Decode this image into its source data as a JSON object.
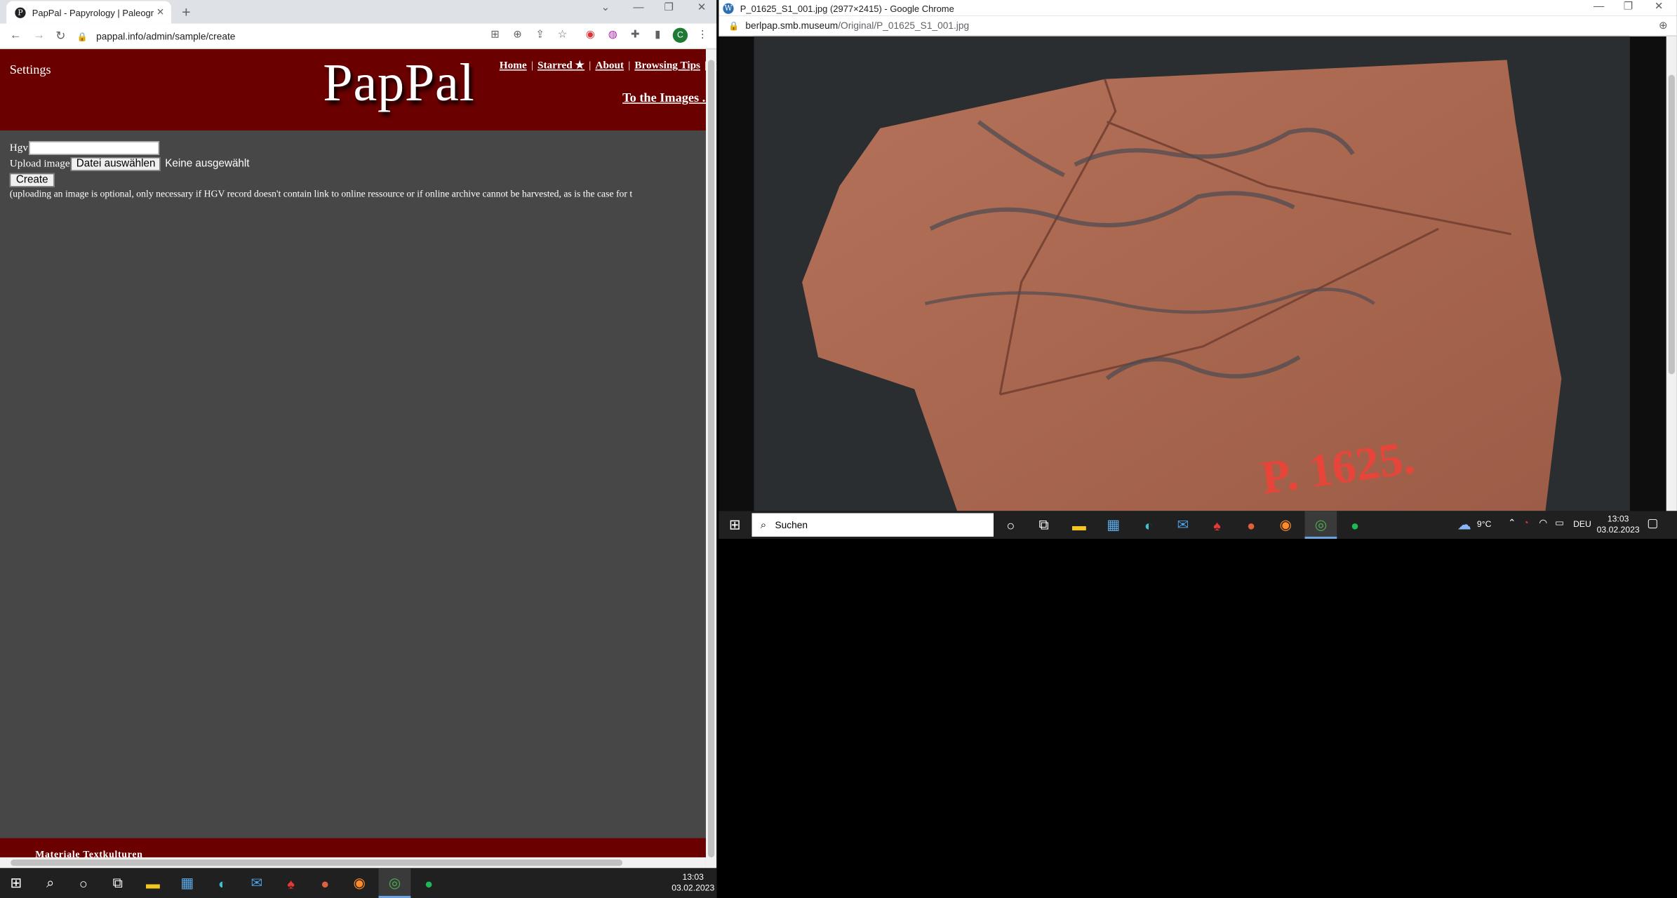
{
  "left_window": {
    "tab_title": "PapPal - Papyrology | Paleograph",
    "tab_close": "✕",
    "new_tab": "+",
    "url": "pappal.info/admin/sample/create",
    "site": {
      "settings": "Settings",
      "logo": "PapPal",
      "nav": [
        "Home",
        "Starred ★",
        "About",
        "Browsing Tips",
        "G"
      ],
      "to_images": "To the Images ..."
    },
    "form": {
      "hgv_label": "Hgv",
      "upload_label": "Upload image",
      "file_button": "Datei auswählen",
      "file_none": "Keine ausgewählt",
      "create_button": "Create",
      "note": "(uploading an image is optional, only necessary if HGV record doesn't contain link to online ressource or if online archive cannot be harvested, as is the case for t"
    },
    "footer_text": "Materiale Textkulturen"
  },
  "right_window": {
    "title": "P_01625_S1_001.jpg (2977×2415) - Google Chrome",
    "url_host": "berlpap.smb.museum",
    "url_path": "/Original/P_01625_S1_001.jpg",
    "image_label": "P. 1625.",
    "search_placeholder": "Suchen",
    "weather": "9°C",
    "lang": "DEU",
    "time": "13:03",
    "date": "03.02.2023"
  },
  "taskbar": {
    "time": "13:03",
    "date": "03.02.2023"
  },
  "colors": {
    "pappal_red": "#6b0000",
    "page_bg": "#474747"
  }
}
